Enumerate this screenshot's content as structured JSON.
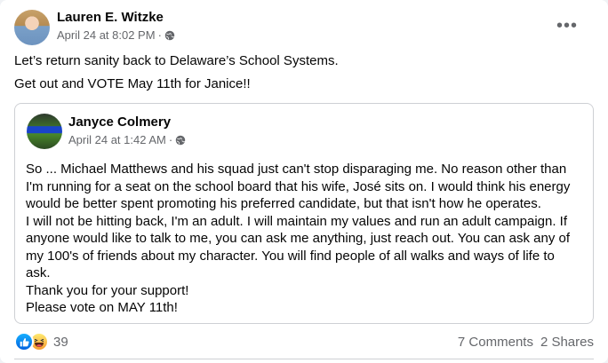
{
  "post": {
    "author": "Lauren E. Witzke",
    "date": "April 24 at 8:02 PM",
    "separator": "·",
    "privacy_icon": "globe-icon",
    "more_icon": "more-options-icon",
    "lines": [
      "Let’s return sanity back to Delaware’s School Systems.",
      "Get out and VOTE May 11th for Janice!!"
    ]
  },
  "shared_post": {
    "author": "Janyce Colmery",
    "date": "April 24 at 1:42 AM",
    "separator": "·",
    "privacy_icon": "globe-icon",
    "body_lines": [
      "So ... Michael Matthews and his squad just can't stop disparaging me. No reason other than",
      "I'm running for a seat on the school board that his wife, José sits on. I would think his energy",
      "would be better spent promoting his preferred candidate, but that isn't how he operates.",
      "I will not be hitting back, I'm an adult. I will maintain my values and run an adult campaign. If",
      "anyone would like to talk to me, you can ask me anything, just reach out. You can ask any of",
      "my 100's of friends about my character. You will find people of all walks and ways of life to",
      "ask.",
      "Thank you for your support!",
      "Please vote on MAY 11th!"
    ]
  },
  "footer": {
    "reactions": [
      "like-icon",
      "haha-icon"
    ],
    "reaction_count": "39",
    "comments": "7 Comments",
    "shares": "2 Shares"
  },
  "colors": {
    "secondary_text": "#65676b",
    "primary_text": "#050505",
    "like_blue": "#1877f2",
    "border": "#ced0d4"
  }
}
